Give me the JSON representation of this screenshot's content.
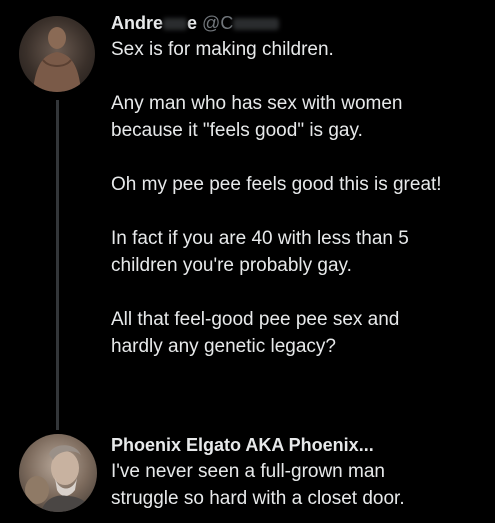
{
  "thread": {
    "tweets": [
      {
        "author_name_visible": "Andre",
        "author_name_tail": "e",
        "handle_prefix": "@C",
        "paragraphs": [
          "Sex is for making children.",
          "Any man who has sex with women\nbecause it \"feels good\" is gay.",
          "Oh my pee pee feels good this is great!",
          "In fact if you are 40 with less than 5\nchildren you're probably gay.",
          "All that feel-good pee pee sex and\nhardly any genetic legacy?"
        ]
      },
      {
        "author_name": "Phoenix Elgato AKA Phoenix...",
        "text": "I've never seen a full-grown man\nstruggle so hard with a closet door."
      }
    ]
  },
  "colors": {
    "background": "#000000",
    "text_primary": "#e7e9ea",
    "text_secondary": "#71767b",
    "thread_line": "#333639"
  }
}
